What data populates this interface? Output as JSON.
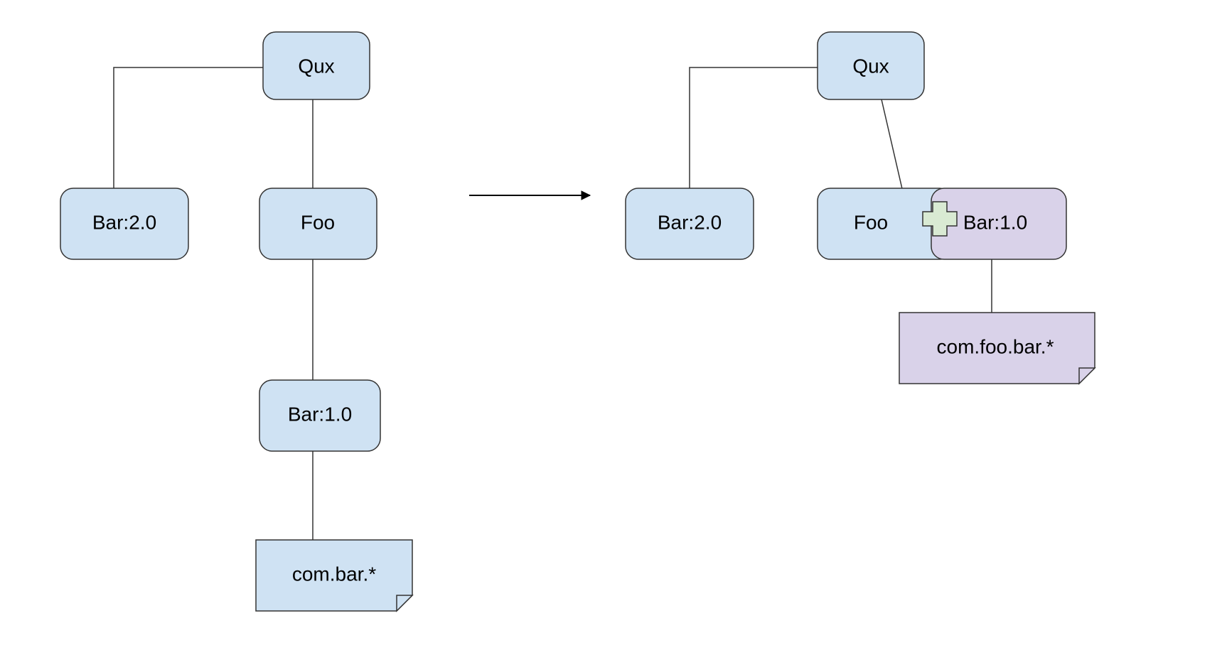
{
  "left": {
    "qux": "Qux",
    "bar20": "Bar:2.0",
    "foo": "Foo",
    "bar10": "Bar:1.0",
    "note": "com.bar.*"
  },
  "right": {
    "qux": "Qux",
    "bar20": "Bar:2.0",
    "foo": "Foo",
    "bar10": "Bar:1.0",
    "note": "com.foo.bar.*"
  }
}
